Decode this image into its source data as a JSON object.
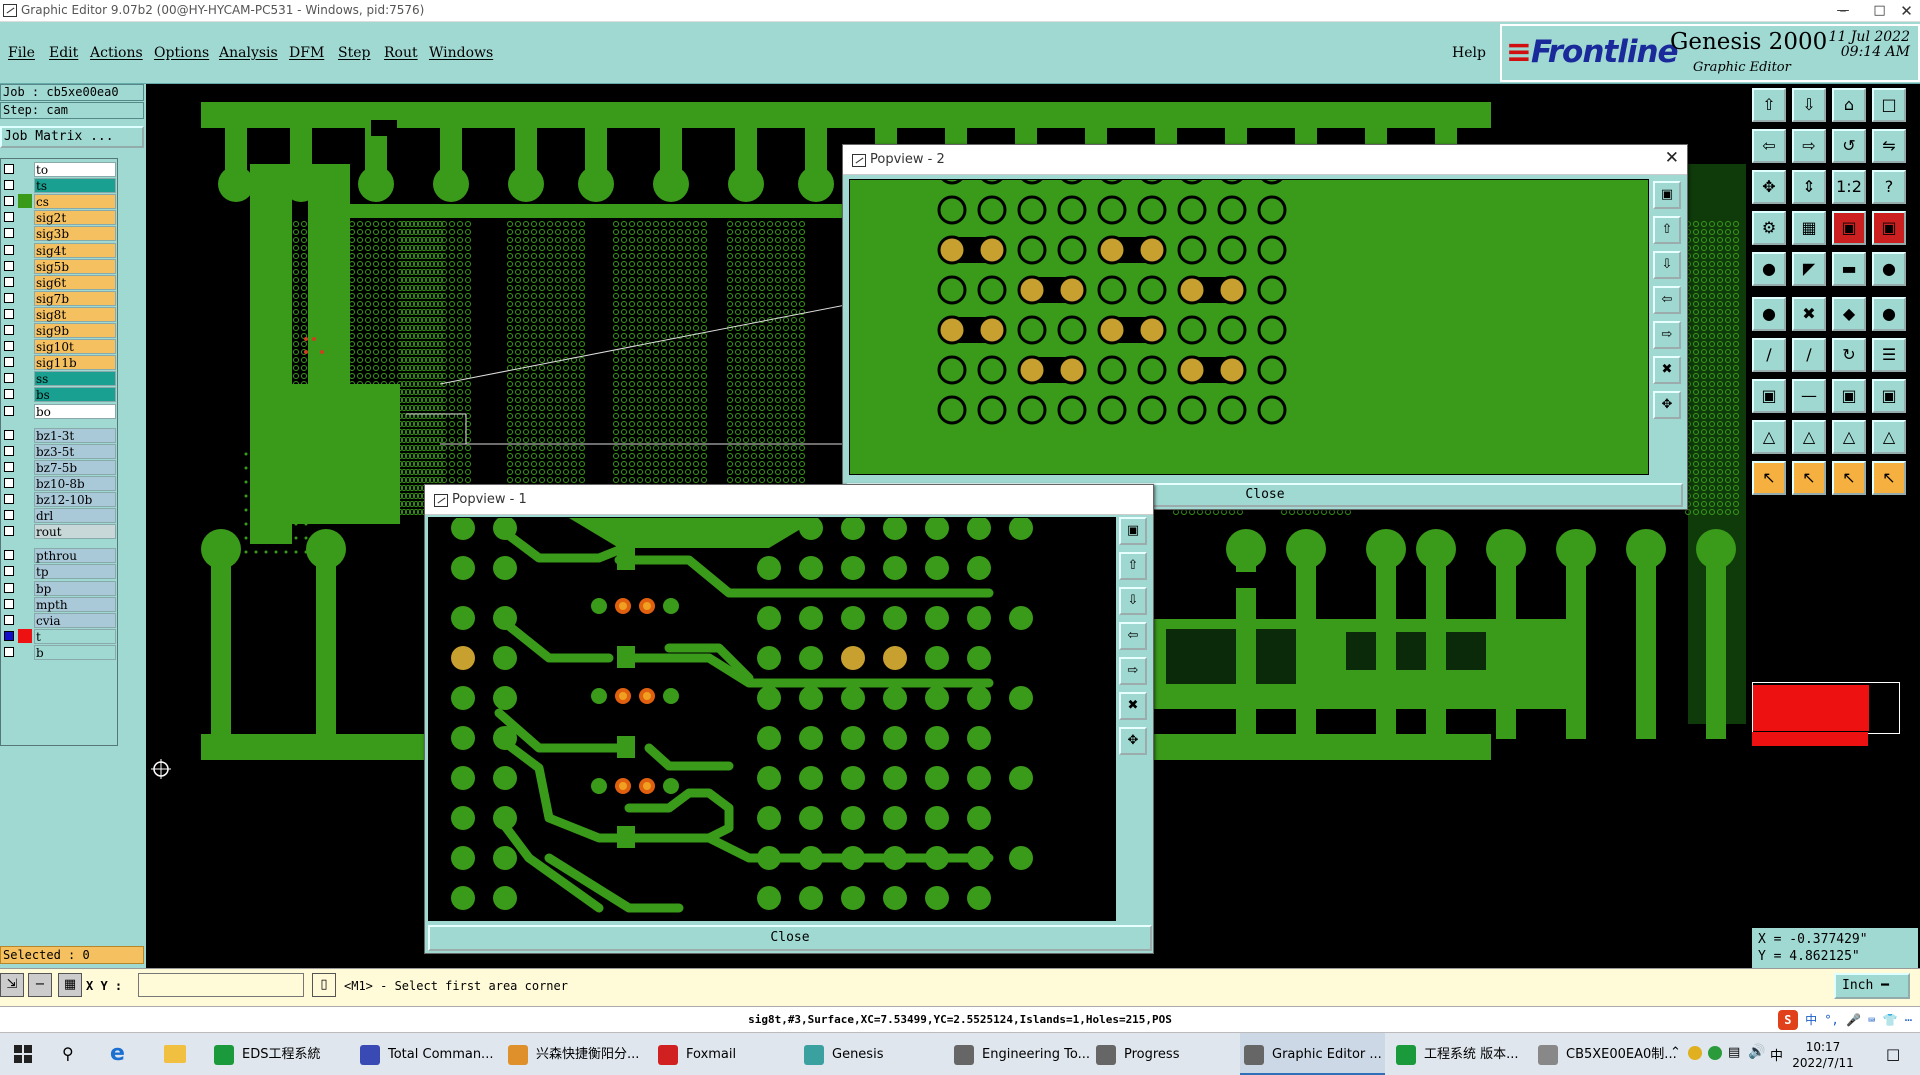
{
  "window": {
    "title": "Graphic Editor 9.07b2 (00@HY-HYCAM-PC531 - Windows, pid:7576)"
  },
  "menu": {
    "items": [
      "File",
      "Edit",
      "Actions",
      "Options",
      "Analysis",
      "DFM",
      "Step",
      "Rout",
      "Windows"
    ],
    "help": "Help"
  },
  "brand": {
    "logo": "Frontline",
    "product": "Genesis 2000",
    "subtitle": "Graphic Editor",
    "date": "11 Jul 2022",
    "time": "09:14 AM"
  },
  "left": {
    "job": "Job : cb5xe00ea0",
    "step": "Step: cam",
    "job_matrix": "Job Matrix ...",
    "selected": "Selected : 0",
    "layers": [
      {
        "name": "to",
        "color": "#ffffff",
        "bg": "#ffffff",
        "checked": false
      },
      {
        "name": "ts",
        "color": "#1aa090",
        "bg": "#1aa090",
        "checked": false
      },
      {
        "name": "cs",
        "color": "#f5c060",
        "bg": "#f5c060",
        "checked": false,
        "swatch": "#3a9a1a"
      },
      {
        "name": "sig2t",
        "color": "#f5c060",
        "bg": "#f5c060",
        "checked": false
      },
      {
        "name": "sig3b",
        "color": "#f5c060",
        "bg": "#f5c060",
        "checked": false
      },
      {
        "name": "sig4t",
        "color": "#f5c060",
        "bg": "#f5c060",
        "checked": false
      },
      {
        "name": "sig5b",
        "color": "#f5c060",
        "bg": "#f5c060",
        "checked": false
      },
      {
        "name": "sig6t",
        "color": "#f5c060",
        "bg": "#f5c060",
        "checked": false
      },
      {
        "name": "sig7b",
        "color": "#f5c060",
        "bg": "#f5c060",
        "checked": false
      },
      {
        "name": "sig8t",
        "color": "#f5c060",
        "bg": "#f5c060",
        "checked": false
      },
      {
        "name": "sig9b",
        "color": "#f5c060",
        "bg": "#f5c060",
        "checked": false
      },
      {
        "name": "sig10t",
        "color": "#f5c060",
        "bg": "#f5c060",
        "checked": false
      },
      {
        "name": "sig11b",
        "color": "#f5c060",
        "bg": "#f5c060",
        "checked": false
      },
      {
        "name": "ss",
        "color": "#1aa090",
        "bg": "#1aa090",
        "checked": false
      },
      {
        "name": "bs",
        "color": "#1aa090",
        "bg": "#1aa090",
        "checked": false
      },
      {
        "name": "bo",
        "color": "#ffffff",
        "bg": "#ffffff",
        "checked": false
      },
      {
        "name": "bz1-3t",
        "color": "#a9c8d8",
        "bg": "#a9c8d8",
        "checked": false
      },
      {
        "name": "bz3-5t",
        "color": "#a9c8d8",
        "bg": "#a9c8d8",
        "checked": false
      },
      {
        "name": "bz7-5b",
        "color": "#a9c8d8",
        "bg": "#a9c8d8",
        "checked": false
      },
      {
        "name": "bz10-8b",
        "color": "#a9c8d8",
        "bg": "#a9c8d8",
        "checked": false
      },
      {
        "name": "bz12-10b",
        "color": "#a9c8d8",
        "bg": "#a9c8d8",
        "checked": false
      },
      {
        "name": "drl",
        "color": "#a9c8d8",
        "bg": "#a9c8d8",
        "checked": false
      },
      {
        "name": "rout",
        "color": "#c8d8d8",
        "bg": "#c8d8d8",
        "checked": false
      },
      {
        "name": "pthrou",
        "color": "#a9c8d8",
        "bg": "#a9c8d8",
        "checked": false
      },
      {
        "name": "tp",
        "color": "#a9c8d8",
        "bg": "#a9c8d8",
        "checked": false
      },
      {
        "name": "bp",
        "color": "#a9c8d8",
        "bg": "#a9c8d8",
        "checked": false
      },
      {
        "name": "mpth",
        "color": "#a9c8d8",
        "bg": "#a9c8d8",
        "checked": false
      },
      {
        "name": "cvia",
        "color": "#a9c8d8",
        "bg": "#a9c8d8",
        "checked": false
      },
      {
        "name": "t",
        "color": "#a0d8d2",
        "bg": "#a0d8d2",
        "checked": true,
        "swatch": "#ee1111"
      },
      {
        "name": "b",
        "color": "#a0d8d2",
        "bg": "#a0d8d2",
        "checked": false
      }
    ]
  },
  "popview1": {
    "title": "Popview - 1",
    "close": "Close"
  },
  "popview2": {
    "title": "Popview - 2",
    "close": "Close"
  },
  "coords": {
    "x": "X = -0.377429\"",
    "y": "Y = 4.862125\""
  },
  "command": {
    "xy_label": "X Y :",
    "xy_value": "",
    "prompt": "<M1> - Select first area corner",
    "units": "Inch"
  },
  "status": {
    "text": "sig8t,#3,Surface,XC=7.53499,YC=2.5525124,Islands=1,Holes=215,POS"
  },
  "taskbar": {
    "items": [
      {
        "label": "EDS工程系統",
        "color": "#1a9a3a"
      },
      {
        "label": "Total Comman...",
        "color": "#3a4ab5"
      },
      {
        "label": "兴森快捷衡阳分...",
        "color": "#e0902a"
      },
      {
        "label": "Foxmail",
        "color": "#d02020"
      },
      {
        "label": "Genesis",
        "color": "#3aa0a0"
      },
      {
        "label": "Engineering To...",
        "color": "#666666"
      },
      {
        "label": "Progress",
        "color": "#666666"
      },
      {
        "label": "Graphic Editor ...",
        "color": "#666666"
      },
      {
        "label": "工程系统   版本...",
        "color": "#1a9a3a"
      },
      {
        "label": "CB5XE00EA0制...",
        "color": "#888888"
      }
    ],
    "time": "10:17",
    "date": "2022/7/11",
    "ime": "中"
  },
  "colors": {
    "cyan": "#a0d8d2",
    "copper": "#3a9a1a",
    "pad_gold": "#c8a030",
    "hilite_red": "#ee1111"
  }
}
